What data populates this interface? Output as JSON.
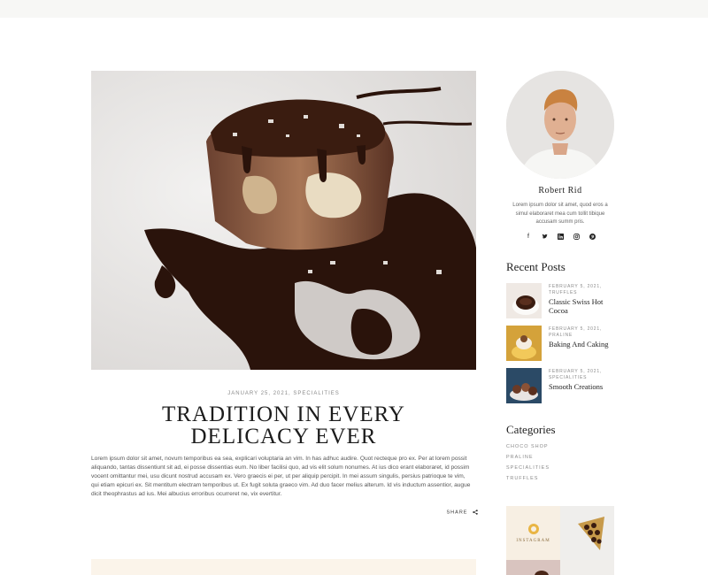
{
  "post": {
    "meta": "JANUARY 25, 2021, SPECIALITIES",
    "title_line1": "TRADITION IN EVERY",
    "title_line2": "DELICACY EVER",
    "body": "Lorem ipsum dolor sit amet, novum temporibus ea sea, explicari voluptaria an vim. In has adhuc audire. Quot recteque pro ex. Per at lorem possit aliquando, tantas dissentiunt sit ad, ei posse dissentias eum. No liber facilisi quo, ad vis elit solum nonumes. At ius dico erant elaboraret, id possim vocent omittantur mei, usu dicunt nostrud accusam ex. Vero graecis ei per, ut per aliquip percipit. In mei assum singulis, persius patrioque te vim, qui etiam epicuri ex. Sit mentitum electram temporibus ut. Ex fugit soluta graeco vim. Ad duo facer melius alterum. Id vis inductum assentior, augue dicit theophrastus ad ius. Mei albucius erroribus ocurreret ne, vix evertitur.",
    "share_label": "SHARE"
  },
  "author": {
    "name": "Robert Rid",
    "bio": "Lorem ipsum dolor sit amet, quod eros a simul elaboraret mea cum tollit tibique accusam summ pris.",
    "socials": [
      "facebook-icon",
      "twitter-icon",
      "linkedin-icon",
      "instagram-icon",
      "pinterest-icon"
    ]
  },
  "recent_posts": {
    "title": "Recent Posts",
    "items": [
      {
        "date": "FEBRUARY 5, 2021,",
        "category": "TRUFFLES",
        "title": "Classic Swiss Hot Cocoa"
      },
      {
        "date": "FEBRUARY 5, 2021,",
        "category": "PRALINE",
        "title": "Baking And Caking"
      },
      {
        "date": "FEBRUARY 5, 2021,",
        "category": "SPECIALITIES",
        "title": "Smooth Creations"
      }
    ]
  },
  "categories": {
    "title": "Categories",
    "items": [
      "CHOCO SHOP",
      "PRALINE",
      "SPECIALITIES",
      "TRUFFLES"
    ]
  },
  "instagram": {
    "badge_text": "INSTAGRAM"
  },
  "colors": {
    "accent_cream": "#fbf4ea",
    "chocolate": "#3b1f14",
    "text_dark": "#1c1c1c"
  }
}
